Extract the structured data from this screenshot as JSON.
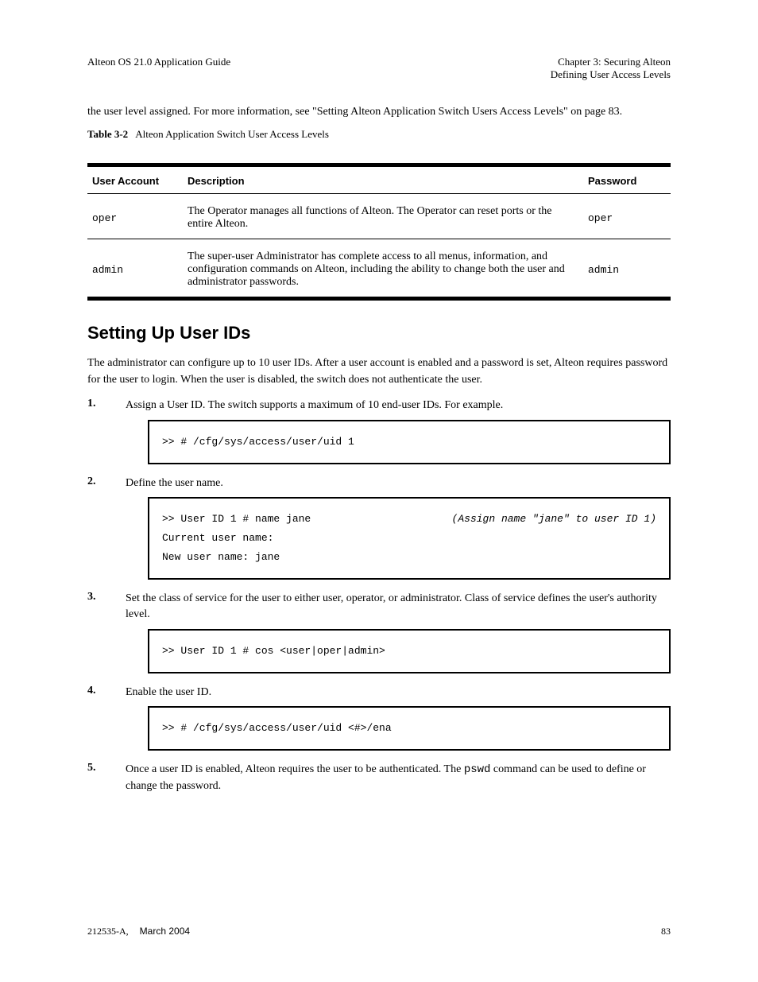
{
  "header": {
    "left_main": "Alteon OS 21.0 Application Guide",
    "right_top": "Chapter 3: Securing Alteon",
    "right_sub": "Defining User Access Levels"
  },
  "intro_para": "the user level assigned. For more information, see \"Setting Alteon Application Switch Users Access Levels\" on page 83.",
  "table": {
    "caption_prefix": "Table 3-2",
    "caption_text": "Alteon Application Switch User Access Levels",
    "headers": [
      "User Account",
      "Description",
      "Password"
    ],
    "rows": [
      {
        "acct": "oper",
        "desc": "The Operator manages all functions of Alteon. The Operator can reset ports or the entire Alteon.",
        "pwd": "oper"
      },
      {
        "acct": "admin",
        "desc": "The super-user Administrator has complete access to all menus, information, and configuration commands on Alteon, including the ability to change both the user and administrator passwords.",
        "pwd": "admin"
      }
    ]
  },
  "section": {
    "title": "Setting Up User IDs",
    "intro": "The administrator can configure up to 10 user IDs. After a user account is enabled and a password is set, Alteon requires password for the user to login. When the user is disabled, the switch does not authenticate the user.",
    "step1": {
      "num": "1.",
      "desc": "Assign a User ID. The switch supports a maximum of 10 end-user IDs. For example."
    },
    "code1": ">> # /cfg/sys/access/user/uid 1",
    "step2": {
      "num": "2.",
      "desc": "Define the user name."
    },
    "code2_line1_left": ">> User ID 1 # name jane",
    "code2_line1_right": "(Assign name \"jane\" to user ID 1)",
    "code2_line2": "Current user name:",
    "code2_line3": "New user name: jane",
    "step3": {
      "num": "3.",
      "desc": "Set the class of service for the user to either user, operator, or administrator. Class of service defines the user's authority level."
    },
    "code3": ">> User ID 1 # cos <user|oper|admin>",
    "step4": {
      "num": "4.",
      "desc": "Enable the user ID."
    },
    "code4": ">> # /cfg/sys/access/user/uid <#>/ena",
    "step5": {
      "num": "5.",
      "desc_prefix": "Once a user ID is enabled, Alteon requires the user to be authenticated. The ",
      "desc_mono": "pswd",
      "desc_suffix": " command can be used to define or change the password."
    }
  },
  "footer": {
    "docnum": "212535-A,",
    "date": "March 2004",
    "page": "83"
  }
}
